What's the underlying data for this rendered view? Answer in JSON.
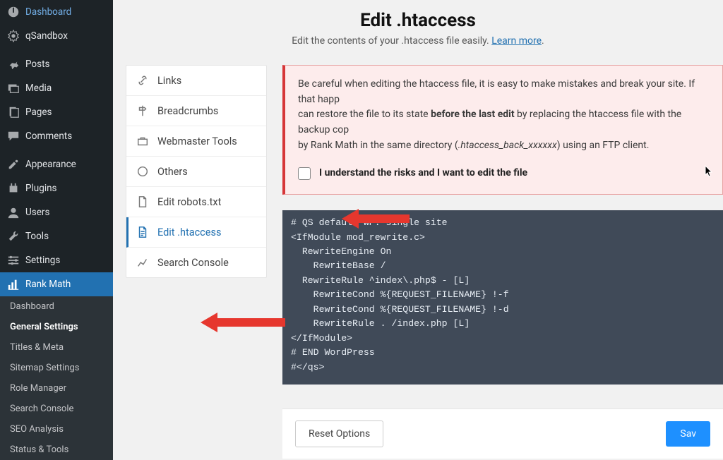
{
  "sidebar": {
    "items": [
      {
        "label": "Dashboard"
      },
      {
        "label": "qSandbox"
      },
      {
        "label": "Posts"
      },
      {
        "label": "Media"
      },
      {
        "label": "Pages"
      },
      {
        "label": "Comments"
      },
      {
        "label": "Appearance"
      },
      {
        "label": "Plugins"
      },
      {
        "label": "Users"
      },
      {
        "label": "Tools"
      },
      {
        "label": "Settings"
      },
      {
        "label": "Rank Math"
      }
    ],
    "submenu": [
      "Dashboard",
      "General Settings",
      "Titles & Meta",
      "Sitemap Settings",
      "Role Manager",
      "Search Console",
      "SEO Analysis",
      "Status & Tools"
    ]
  },
  "header": {
    "title": "Edit .htaccess",
    "subtitle_pre": "Edit the contents of your .htaccess file easily. ",
    "subtitle_link": "Learn more",
    "subtitle_post": "."
  },
  "tabs": [
    "Links",
    "Breadcrumbs",
    "Webmaster Tools",
    "Others",
    "Edit robots.txt",
    "Edit .htaccess",
    "Search Console"
  ],
  "notice": {
    "line1_a": "Be careful when editing the htaccess file, it is easy to make mistakes and break your site. If that happ",
    "line2_a": "can restore the file to its state ",
    "line2_b": "before the last edit",
    "line2_c": " by replacing the htaccess file with the backup cop",
    "line3_a": "by Rank Math in the same directory (",
    "line3_b": ".htaccess_back_xxxxxx",
    "line3_c": ") using an FTP client.",
    "risk_label": "I understand the risks and I want to edit the file"
  },
  "code": "# QS default WP: single site\n<IfModule mod_rewrite.c>\n  RewriteEngine On\n    RewriteBase /\n  RewriteRule ^index\\.php$ - [L]\n    RewriteCond %{REQUEST_FILENAME} !-f\n    RewriteCond %{REQUEST_FILENAME} !-d\n    RewriteRule . /index.php [L]\n</IfModule>\n# END WordPress\n#</qs>",
  "buttons": {
    "reset": "Reset Options",
    "save": "Sav"
  }
}
